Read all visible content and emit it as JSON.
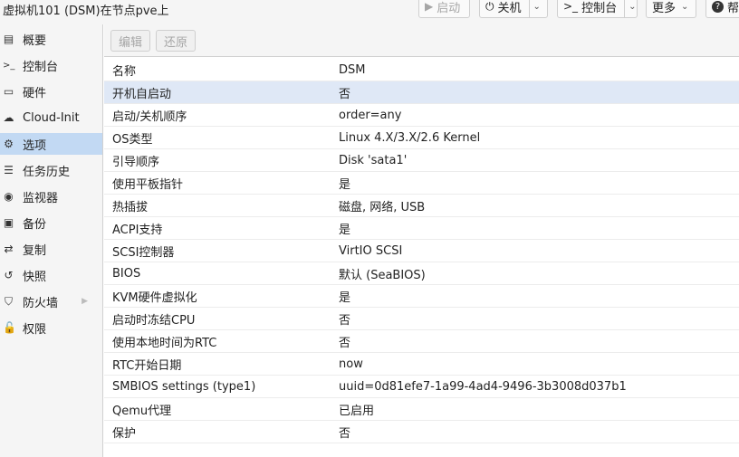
{
  "window": {
    "title": "虚拟机101 (DSM)在节点pve上"
  },
  "toolbar": {
    "start_label": "启动",
    "shutdown_label": "关机",
    "console_label": "控制台",
    "more_label": "更多",
    "help_label": "帮"
  },
  "sidebar": {
    "items": [
      {
        "label": "概要",
        "icon": "book-icon"
      },
      {
        "label": "控制台",
        "icon": "terminal-icon"
      },
      {
        "label": "硬件",
        "icon": "monitor-icon"
      },
      {
        "label": "Cloud-Init",
        "icon": "cloud-icon"
      },
      {
        "label": "选项",
        "icon": "gear-icon"
      },
      {
        "label": "任务历史",
        "icon": "list-icon"
      },
      {
        "label": "监视器",
        "icon": "eye-icon"
      },
      {
        "label": "备份",
        "icon": "floppy-icon"
      },
      {
        "label": "复制",
        "icon": "retweet-icon"
      },
      {
        "label": "快照",
        "icon": "history-icon"
      },
      {
        "label": "防火墙",
        "icon": "shield-icon"
      },
      {
        "label": "权限",
        "icon": "unlock-icon"
      }
    ],
    "active": "选项"
  },
  "options_toolbar": {
    "edit_label": "编辑",
    "revert_label": "还原"
  },
  "options": {
    "rows": [
      {
        "key": "名称",
        "value": "DSM"
      },
      {
        "key": "开机自启动",
        "value": "否"
      },
      {
        "key": "启动/关机顺序",
        "value": "order=any"
      },
      {
        "key": "OS类型",
        "value": "Linux 4.X/3.X/2.6 Kernel"
      },
      {
        "key": "引导顺序",
        "value": "Disk 'sata1'"
      },
      {
        "key": "使用平板指针",
        "value": "是"
      },
      {
        "key": "热插拔",
        "value": "磁盘, 网络, USB"
      },
      {
        "key": "ACPI支持",
        "value": "是"
      },
      {
        "key": "SCSI控制器",
        "value": "VirtIO SCSI"
      },
      {
        "key": "BIOS",
        "value": "默认 (SeaBIOS)"
      },
      {
        "key": "KVM硬件虚拟化",
        "value": "是"
      },
      {
        "key": "启动时冻结CPU",
        "value": "否"
      },
      {
        "key": "使用本地时间为RTC",
        "value": "否"
      },
      {
        "key": "RTC开始日期",
        "value": "now"
      },
      {
        "key": "SMBIOS settings (type1)",
        "value": "uuid=0d81efe7-1a99-4ad4-9496-3b3008d037b1"
      },
      {
        "key": "Qemu代理",
        "value": "已启用"
      },
      {
        "key": "保护",
        "value": "否"
      }
    ],
    "selected_row": "开机自启动"
  },
  "colors": {
    "selected_nav": "#c2d9f3",
    "selected_row": "#dfe8f6",
    "sidebar_bg": "#f5f5f5"
  }
}
